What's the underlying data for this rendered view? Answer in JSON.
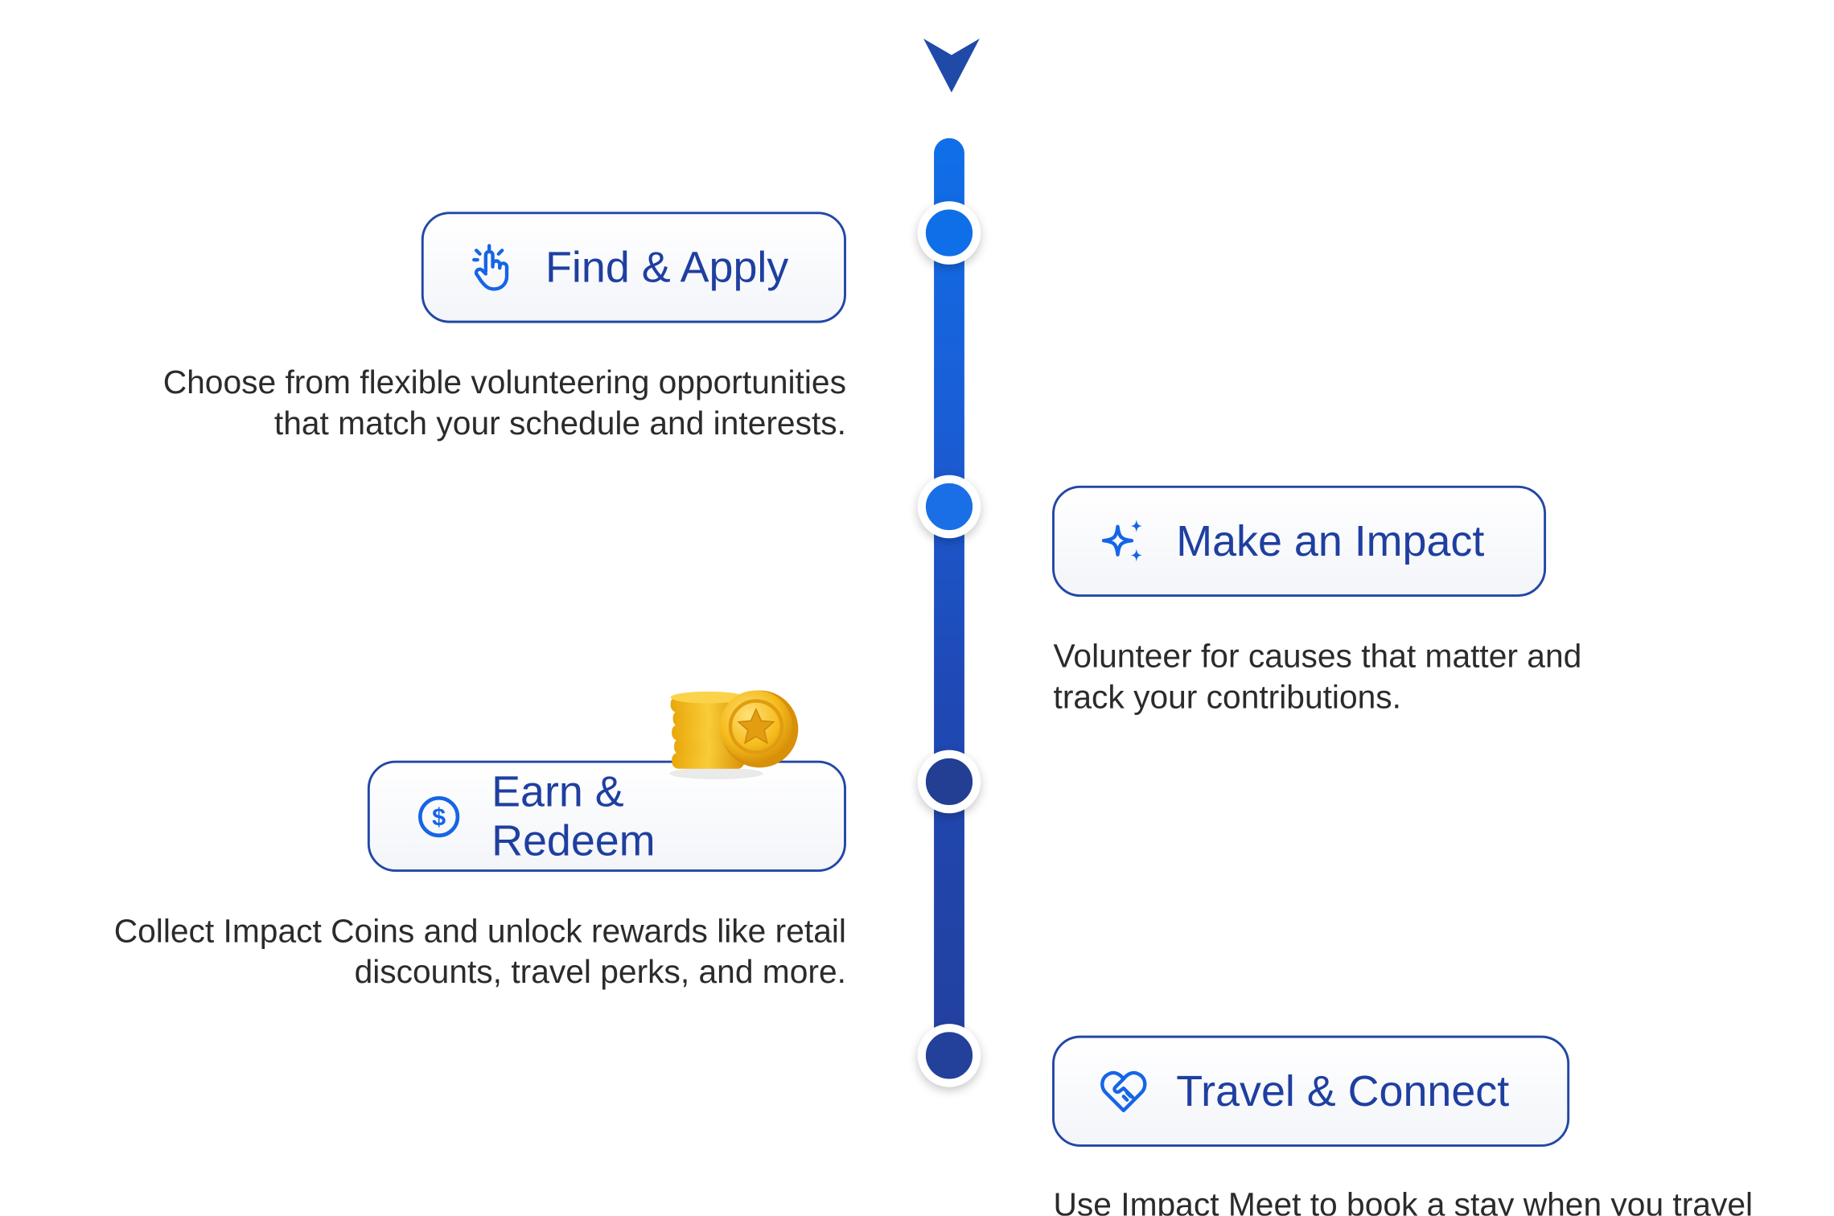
{
  "colors": {
    "accent": "#0f6fe8",
    "pill_border": "#2347a6",
    "pill_text": "#1f3fa0",
    "desc_text": "#2b2b2b",
    "node_1": "#0f6fe8",
    "node_2": "#1a6fe6",
    "node_3": "#233f93",
    "node_4": "#23409a"
  },
  "steps": [
    {
      "title": "Find & Apply",
      "icon": "tap-hand-icon",
      "description_lines": [
        "Choose from flexible volunteering opportunities",
        "that match your schedule and interests."
      ]
    },
    {
      "title": "Make an Impact",
      "icon": "sparkles-icon",
      "description_lines": [
        "Volunteer for causes that matter and",
        "track your contributions."
      ]
    },
    {
      "title": "Earn & Redeem",
      "icon": "dollar-coin-icon",
      "description_lines": [
        "Collect Impact Coins and unlock rewards like retail",
        "discounts, travel perks, and more."
      ]
    },
    {
      "title": "Travel & Connect",
      "icon": "heart-handshake-icon",
      "description_lines": [
        "Use Impact Meet to book a stay when you travel"
      ]
    }
  ],
  "decorations": {
    "top_icon": "chevron-down-icon",
    "coins_image": "gold-coins-stack-icon"
  }
}
